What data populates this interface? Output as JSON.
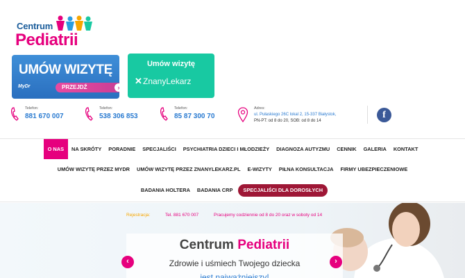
{
  "logo": {
    "line1": "Centrum",
    "line2": "Pediatrii"
  },
  "booking": {
    "mydr": {
      "title": "UMÓW WIZYTĘ",
      "brand": "MyDr",
      "button": "PRZEJDŹ"
    },
    "znanylekarz": {
      "title": "Umów wizytę",
      "brand": "ZnanyLekarz"
    }
  },
  "contacts": [
    {
      "label": "Telefon:",
      "value": "881 670 007"
    },
    {
      "label": "Telefon:",
      "value": "538 306 853"
    },
    {
      "label": "Telefon:",
      "value": "85 87 300 70"
    }
  ],
  "address": {
    "label": "Adres:",
    "line1": "ul. Pułaskiego 26C lokal 2, 15-337 Białystok,",
    "line2": "PN-PT: od 8 do 20, SOB: od 8 do 14"
  },
  "social": {
    "facebook": "f"
  },
  "nav": {
    "row1": [
      "O NAS",
      "NA SKRÓTY",
      "PORADNIE",
      "SPECJALIŚCI",
      "PSYCHIATRIA DZIECI I MŁODZIEŻY",
      "DIAGNOZA AUTYZMU",
      "CENNIK",
      "GALERIA",
      "KONTAKT"
    ],
    "row2": [
      "UMÓW WIZYTĘ PRZEZ MYDR",
      "UMÓW WIZYTĘ PRZEZ ZNANYLEKARZ.PL",
      "E-WIZYTY",
      "PIŁNA KONSULTACJA",
      "FIRMY UBEZPIECZENIOWE"
    ],
    "row3": [
      "BADANIA HOLTERA",
      "BADANIA CRP",
      "SPECJALIŚCI DLA DOROSŁYCH"
    ]
  },
  "hero": {
    "reg_label": "Rejestracja:",
    "reg_phone": "Tel. 881 670 007",
    "reg_hours": "Pracujemy codziennie od 8 do 20 oraz w soboty od 14",
    "title_a": "Centrum",
    "title_b": "Pediatrii",
    "subtitle": "Zdrowie i uśmiech Twojego dziecka",
    "subtitle2": "jest najważniejszy!",
    "prev": "‹",
    "next": "›"
  },
  "colors": {
    "accent": "#e6007e",
    "blue": "#2a7bd1",
    "green": "#18c9a2",
    "dark_red": "#9e1736"
  }
}
